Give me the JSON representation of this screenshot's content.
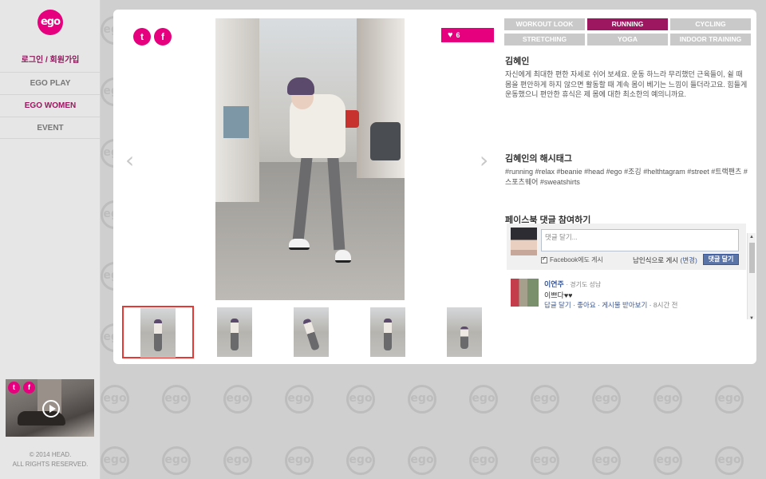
{
  "brand": {
    "logo_text": "ego"
  },
  "sidebar": {
    "login_label": "로그인 / 회원가입",
    "nav": [
      {
        "label": "EGO PLAY"
      },
      {
        "label": "EGO WOMEN"
      },
      {
        "label": "EVENT"
      }
    ],
    "video_social": {
      "twitter": "t",
      "facebook": "f"
    },
    "copyright_line1": "© 2014 HEAD.",
    "copyright_line2": "ALL RIGHTS RESERVED."
  },
  "panel": {
    "social": {
      "twitter": "t",
      "facebook": "f"
    },
    "like_count": "6",
    "nav_prev": "‹",
    "nav_next": "›",
    "tags": [
      {
        "label": "WORKOUT LOOK"
      },
      {
        "label": "RUNNING"
      },
      {
        "label": "CYCLING"
      },
      {
        "label": "STRETCHING"
      },
      {
        "label": "YOGA"
      },
      {
        "label": "INDOOR TRAINING"
      }
    ],
    "selected_tag": "RUNNING",
    "name": "김혜인",
    "description": "자신에게 최대한 편한 자세로 쉬어 보세요. 운동 하느라 무리했던 근육들이, 쉴 때 몸을 편안하게 하지 않으면 활동할 때 계속 몸이 베기는 느낌이 들더라고요. 힘들게 운동했으니 편안한 휴식은 제 몸에 대한 최소한의 예의니까요.",
    "hashtag_title": "김혜인의 해시태그",
    "hashtags": "#running #relax #beanie #head #ego #조깅 #helthtagram #street #트랙팬츠 #스포츠웨어 #sweatshirts",
    "facebook": {
      "title": "페이스북 댓글 참여하기",
      "placeholder": "댓글 달기...",
      "also_post_label": "Facebook에도 게시",
      "anon_label": "남인식으로 게시",
      "anon_change": "(변경)",
      "submit_label": "댓글 달기",
      "comment": {
        "author": "이연주",
        "location": "· 경기도 성남",
        "text": "이쁘다♥♥",
        "actions": "답글 달기 · 좋아요 · 게시물 받아보기 ·",
        "time": "8시간 전"
      }
    }
  }
}
